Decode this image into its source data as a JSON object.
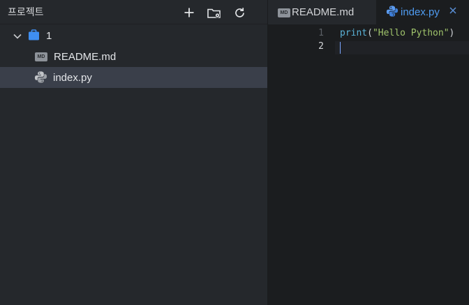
{
  "sidebar": {
    "title": "프로젝트",
    "actions": [
      {
        "name": "new-file",
        "icon": "plus-icon"
      },
      {
        "name": "new-folder",
        "icon": "folder-gear-icon"
      },
      {
        "name": "refresh",
        "icon": "refresh-icon"
      }
    ],
    "tree": {
      "root": {
        "label": "1",
        "icon": "folder-icon",
        "expanded": true
      },
      "files": [
        {
          "label": "README.md",
          "icon": "markdown-icon",
          "icon_text": "MD",
          "selected": false
        },
        {
          "label": "index.py",
          "icon": "python-icon",
          "selected": true
        }
      ]
    }
  },
  "tabs": [
    {
      "label": "README.md",
      "icon": "markdown-icon",
      "icon_text": "MD",
      "active": false
    },
    {
      "label": "index.py",
      "icon": "python-icon",
      "active": true
    }
  ],
  "editor": {
    "line_numbers": [
      "1",
      "2"
    ],
    "line1": {
      "fn": "print",
      "open": "(",
      "str": "\"Hello Python\"",
      "close": ")"
    }
  },
  "colors": {
    "accent": "#4f9cf2",
    "selection": "#3a3f4a",
    "string": "#9fc36b",
    "function": "#5ab3d8"
  }
}
